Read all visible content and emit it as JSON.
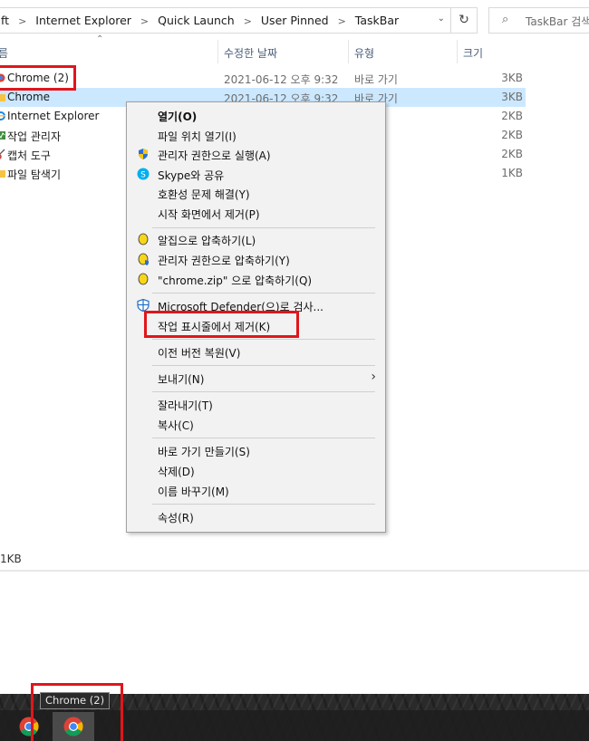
{
  "address_bar": {
    "crumbs": [
      "ft",
      "Internet Explorer",
      "Quick Launch",
      "User Pinned",
      "TaskBar"
    ],
    "separator": ">",
    "search_placeholder": "TaskBar 검색"
  },
  "columns": {
    "name": "름",
    "date": "수정한 날짜",
    "type": "유형",
    "size": "크기"
  },
  "files": [
    {
      "name": "Chrome (2)",
      "date": "2021-06-12 오후 9:32",
      "type": "바로 가기",
      "size": "3KB",
      "icon": "chrome-icon"
    },
    {
      "name": "Chrome",
      "date": "2021-06-12 오후 9:32",
      "type": "바로 가기",
      "size": "3KB",
      "icon": "folder-icon"
    },
    {
      "name": "Internet Explorer",
      "date": "",
      "type": "가기",
      "size": "2KB",
      "icon": "ie-icon"
    },
    {
      "name": "작업 관리자",
      "date": "",
      "type": "가기",
      "size": "2KB",
      "icon": "task-manager-icon"
    },
    {
      "name": "캡처 도구",
      "date": "",
      "type": "가기",
      "size": "2KB",
      "icon": "snipping-tool-icon"
    },
    {
      "name": "파일 탐색기",
      "date": "",
      "type": "가기",
      "size": "1KB",
      "icon": "folder-icon"
    }
  ],
  "status": {
    "text": "1KB"
  },
  "context_menu": {
    "items": [
      {
        "label": "열기(O)",
        "bold": true
      },
      {
        "label": "파일 위치 열기(I)"
      },
      {
        "label": "관리자 권한으로 실행(A)",
        "icon": "uac-shield-icon"
      },
      {
        "label": "Skype와 공유",
        "icon": "skype-icon"
      },
      {
        "label": "호환성 문제 해결(Y)"
      },
      {
        "label": "시작 화면에서 제거(P)"
      },
      {
        "label": "알집으로 압축하기(L)",
        "icon": "alzip-icon"
      },
      {
        "label": "관리자 권한으로 압축하기(Y)",
        "icon": "alzip-admin-icon"
      },
      {
        "label": "\"chrome.zip\" 으로 압축하기(Q)",
        "icon": "alzip-icon"
      },
      {
        "label": "Microsoft Defender(으)로 검사...",
        "icon": "defender-icon"
      },
      {
        "label": "작업 표시줄에서 제거(K)"
      },
      {
        "label": "이전 버전 복원(V)"
      },
      {
        "label": "보내기(N)",
        "submenu": true
      },
      {
        "label": "잘라내기(T)"
      },
      {
        "label": "복사(C)"
      },
      {
        "label": "바로 가기 만들기(S)"
      },
      {
        "label": "삭제(D)"
      },
      {
        "label": "이름 바꾸기(M)"
      },
      {
        "label": "속성(R)"
      }
    ]
  },
  "taskbar": {
    "tooltip": "Chrome (2)"
  },
  "colors": {
    "highlight": "#e0161b",
    "selection": "#cce8ff",
    "menu_bg": "#f2f2f2"
  }
}
